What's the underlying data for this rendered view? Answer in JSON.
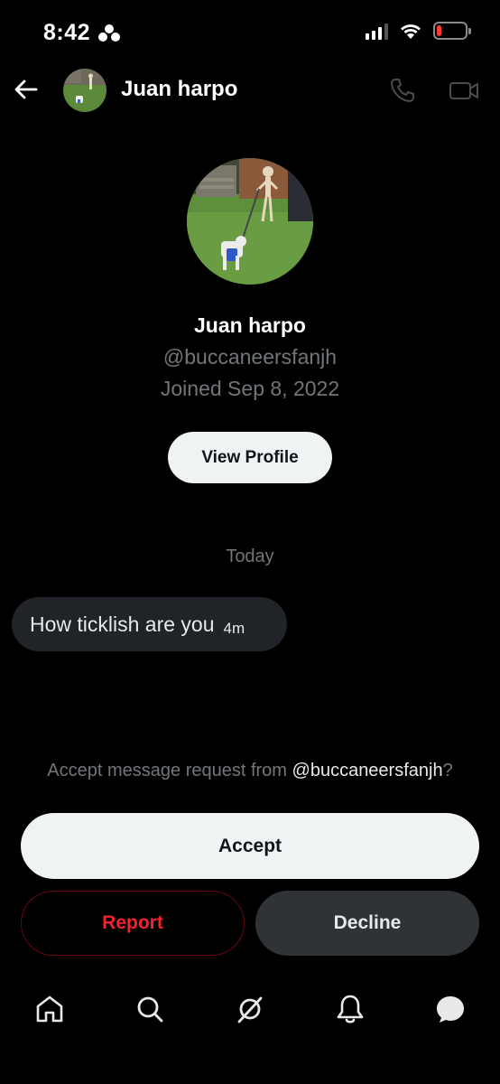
{
  "status_bar": {
    "time": "8:42",
    "battery_level": 0.18,
    "battery_color": "#ff3b30"
  },
  "header": {
    "name": "Juan harpo",
    "icons": [
      "back-arrow-icon",
      "phone-icon",
      "video-camera-icon"
    ]
  },
  "profile": {
    "name": "Juan harpo",
    "handle": "@buccaneersfanjh",
    "joined": "Joined Sep 8, 2022",
    "view_profile_label": "View Profile"
  },
  "conversation": {
    "date_separator": "Today",
    "messages": [
      {
        "text": "How ticklish are you",
        "time": "4m"
      }
    ]
  },
  "request": {
    "prompt_prefix": "Accept message request from ",
    "prompt_handle": "@buccaneersfanjh",
    "prompt_suffix": "?",
    "accept_label": "Accept",
    "report_label": "Report",
    "decline_label": "Decline"
  },
  "bottom_nav": {
    "items": [
      "home-icon",
      "search-icon",
      "grok-icon",
      "notifications-icon",
      "messages-icon"
    ]
  },
  "colors": {
    "background": "#000000",
    "secondary_text": "#71767b",
    "report_red": "#f4212e",
    "bubble": "#202327",
    "decline_bg": "#2f3336"
  }
}
